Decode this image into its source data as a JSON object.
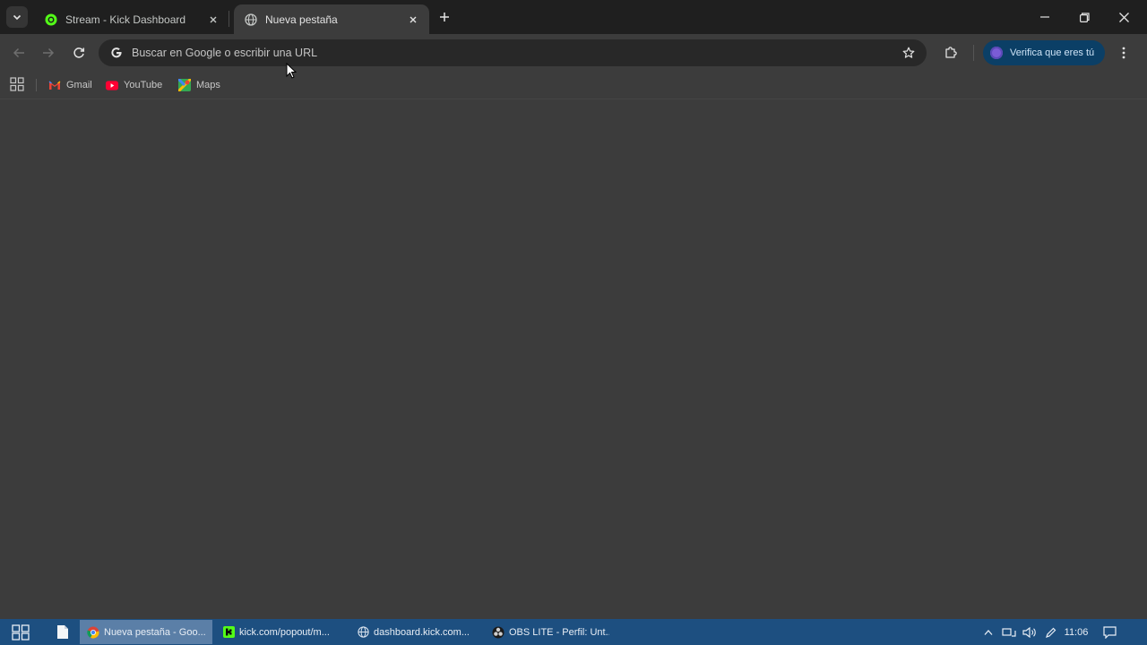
{
  "tabs": [
    {
      "title": "Stream - Kick Dashboard",
      "active": false
    },
    {
      "title": "Nueva pestaña",
      "active": true
    }
  ],
  "omnibox": {
    "placeholder": "Buscar en Google o escribir una URL"
  },
  "profile": {
    "label": "Verifica que eres tú"
  },
  "bookmarks": [
    {
      "label": "Gmail",
      "icon": "gmail-icon"
    },
    {
      "label": "YouTube",
      "icon": "youtube-icon"
    },
    {
      "label": "Maps",
      "icon": "maps-icon"
    }
  ],
  "taskbar": {
    "tasks": [
      {
        "label": "Nueva pestaña - Goo...",
        "icon": "chrome-icon",
        "active": true
      },
      {
        "label": "kick.com/popout/m...",
        "icon": "kick-icon",
        "active": false
      },
      {
        "label": "dashboard.kick.com...",
        "icon": "globe-icon",
        "active": false
      },
      {
        "label": "OBS LITE - Perfil: Unt...",
        "icon": "obs-icon",
        "active": false
      }
    ],
    "clock": "11:06"
  },
  "colors": {
    "tabstrip": "#1f1f1f",
    "content": "#3c3c3c",
    "omnibox": "#282828",
    "profile_pill": "#0b3f66",
    "taskbar": "#1d4f80",
    "kick_green": "#53fc18"
  }
}
